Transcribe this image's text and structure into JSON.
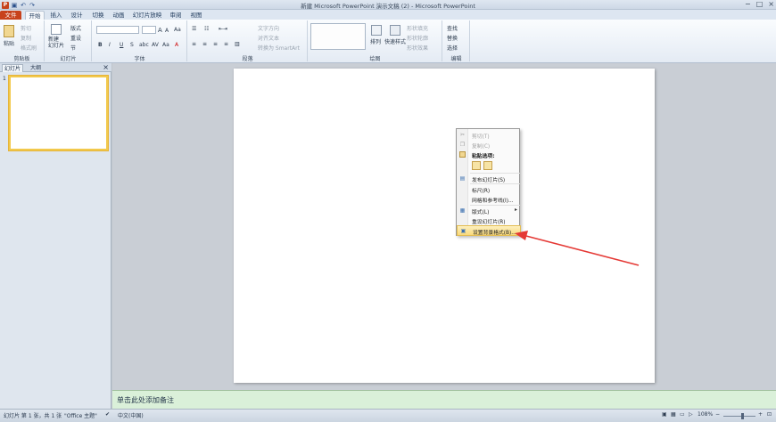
{
  "window": {
    "title": "新建 Microsoft PowerPoint 演示文稿 (2) - Microsoft PowerPoint",
    "controls": [
      "−",
      "□",
      "×"
    ]
  },
  "qat": {
    "app": "P",
    "icons": [
      "save-icon",
      "undo-icon",
      "redo-icon"
    ]
  },
  "tabs": [
    {
      "label": "文件"
    },
    {
      "label": "开始"
    },
    {
      "label": "插入"
    },
    {
      "label": "设计"
    },
    {
      "label": "切换"
    },
    {
      "label": "动画"
    },
    {
      "label": "幻灯片放映"
    },
    {
      "label": "审阅"
    },
    {
      "label": "视图"
    }
  ],
  "ribbon": {
    "clipboard": {
      "label": "剪贴板",
      "paste": "粘贴",
      "cut": "剪切",
      "copy": "复制",
      "painter": "格式刷"
    },
    "slides": {
      "label": "幻灯片",
      "new_slide": "新建\n幻灯片",
      "layout": "版式",
      "reset": "重设",
      "section": "节"
    },
    "font": {
      "label": "字体",
      "size_buttons": [
        "A",
        "A",
        "Aa"
      ]
    },
    "paragraph": {
      "label": "段落",
      "text_dir": "文字方向",
      "align_text": "对齐文本",
      "smartart": "转换为 SmartArt"
    },
    "drawing": {
      "label": "绘图",
      "arrange": "排列",
      "quick_styles": "快速样式",
      "fill": "形状填充",
      "outline": "形状轮廓",
      "effects": "形状效果"
    },
    "editing": {
      "label": "编辑",
      "find": "查找",
      "replace": "替换",
      "select": "选择"
    }
  },
  "left_pane": {
    "tabs": [
      "幻灯片",
      "大纲"
    ],
    "close": "×",
    "slide_number": "1"
  },
  "notes": {
    "placeholder": "单击此处添加备注"
  },
  "context_menu": {
    "items": [
      {
        "label": "剪切(T)",
        "enabled": false,
        "icon": "scissors-icon"
      },
      {
        "label": "复制(C)",
        "enabled": false,
        "icon": "copy-icon"
      },
      {
        "label": "粘贴选项:",
        "header": true,
        "icon": "paste-icon"
      },
      {
        "label": "发布幻灯片(S)",
        "icon": "publish-icon"
      },
      {
        "label": "标尺(R)"
      },
      {
        "label": "网格和参考线(I)..."
      },
      {
        "label": "版式(L)",
        "submenu": true,
        "icon": "layout-icon"
      },
      {
        "label": "重设幻灯片(R)"
      },
      {
        "label": "设置背景格式(B)...",
        "highlighted": true,
        "icon": "background-icon"
      }
    ],
    "submenu_arrow": "▸"
  },
  "annotation": {
    "color": "#e53935"
  },
  "status": {
    "slide_info": "幻灯片 第 1 张，共 1 张",
    "theme": "\"Office 主题\"",
    "language": "中文(中国)",
    "zoom": "108%"
  }
}
